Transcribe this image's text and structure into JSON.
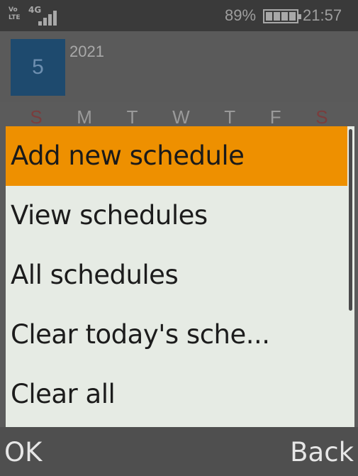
{
  "status_bar": {
    "volte_top": "Vo",
    "volte_bottom": "LTE",
    "network": "4G",
    "battery_percent": "89%",
    "time": "21:57"
  },
  "calendar": {
    "day": "5",
    "year": "2021",
    "weekdays": [
      "S",
      "M",
      "T",
      "W",
      "T",
      "F",
      "S"
    ]
  },
  "menu": {
    "items": [
      {
        "label": "Add new schedule",
        "selected": true
      },
      {
        "label": "View schedules",
        "selected": false
      },
      {
        "label": "All schedules",
        "selected": false
      },
      {
        "label": "Clear today's sche...",
        "selected": false
      },
      {
        "label": "Clear all",
        "selected": false
      }
    ]
  },
  "softkeys": {
    "left": "OK",
    "right": "Back"
  },
  "colors": {
    "selection": "#ee9000",
    "menu_background": "#e6ebe4",
    "day_box": "#1e4a6e"
  }
}
